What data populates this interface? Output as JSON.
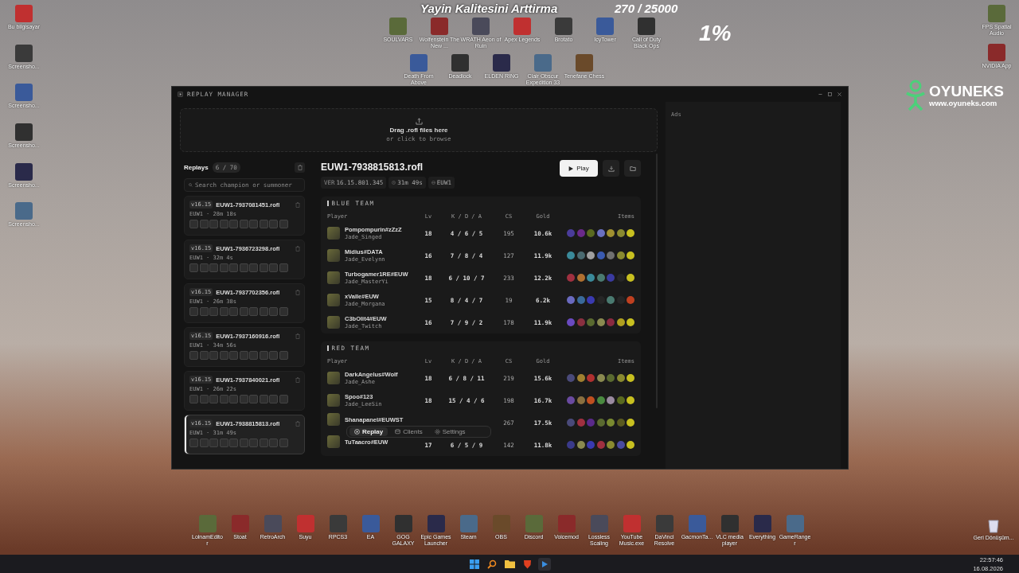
{
  "stream_overlay": {
    "title": "Yayin Kalitesini Arttirma",
    "counter": "270 / 25000",
    "percent": "1%"
  },
  "desktop_icons_top": [
    "SOULVARS",
    "Wolfenstein The New ...",
    "WRATH Aeon of Ruin",
    "Apex Legends",
    "Brotato",
    "IcyTower",
    "Call of Duty Black Ops"
  ],
  "desktop_icons_second": [
    "Death From Above",
    "Deadlock",
    "ELDEN RING",
    "Clair Obscur Expedition 33",
    "Tenefane Chess"
  ],
  "desktop_icons_left": [
    "Bu bilgisayar",
    "Screensho...",
    "Screensho...",
    "Screensho...",
    "Screensho...",
    "Screensho..."
  ],
  "desktop_icons_right": [
    "FPS Spatial Audio",
    "NVIDIA App"
  ],
  "logo": {
    "name": "OYUNEKS",
    "url": "www.oyuneks.com"
  },
  "window": {
    "title": "REPLAY MANAGER",
    "ads_label": "Ads",
    "drop_zone": {
      "title": "Drag .rofl files here",
      "hint": "or click to browse"
    },
    "sidebar": {
      "title": "Replays",
      "count": "6 / 70",
      "search_placeholder": "Search champion or summoner",
      "replays": [
        {
          "version": "v16.15",
          "file": "EUW1-7937081451.rofl",
          "meta": "EUW1 · 28m 18s",
          "selected": false
        },
        {
          "version": "v16.15",
          "file": "EUW1-7936723298.rofl",
          "meta": "EUW1 · 32m 4s",
          "selected": false
        },
        {
          "version": "v16.15",
          "file": "EUW1-7937702356.rofl",
          "meta": "EUW1 · 26m 38s",
          "selected": false
        },
        {
          "version": "v16.15",
          "file": "EUW1-7937160916.rofl",
          "meta": "EUW1 · 34m 56s",
          "selected": false
        },
        {
          "version": "v16.15",
          "file": "EUW1-7937840021.rofl",
          "meta": "EUW1 · 26m 22s",
          "selected": false
        },
        {
          "version": "v16.15",
          "file": "EUW1-7938815813.rofl",
          "meta": "EUW1 · 31m 49s",
          "selected": true
        }
      ]
    },
    "detail": {
      "title": "EUW1-7938815813.rofl",
      "play": "Play",
      "chips": [
        {
          "kind": "version",
          "label": "VER",
          "value": "16.15.801.345"
        },
        {
          "kind": "duration",
          "value": "31m 49s"
        },
        {
          "kind": "region",
          "value": "EUW1"
        }
      ],
      "teams": [
        {
          "name": "BLUE TEAM",
          "columns": [
            "Player",
            "Lv",
            "K / D / A",
            "CS",
            "Gold",
            "Items"
          ],
          "players": [
            {
              "name": "Pompompurin#zZzZ",
              "champion": "Jade_Singed",
              "level": "18",
              "kda": "4 / 6 / 5",
              "cs": "195",
              "gold": "10.6k",
              "items": [
                {
                  "color": "#4a3c9a"
                },
                {
                  "color": "#6a2a8a"
                },
                {
                  "color": "#5a6a20"
                },
                {
                  "color": "#6a70c0"
                },
                {
                  "color": "#a09030"
                },
                {
                  "color": "#8a8a30"
                },
                {
                  "color": "#c8c020"
                }
              ]
            },
            {
              "name": "Midius#DATA",
              "champion": "Jade_Evelynn",
              "level": "16",
              "kda": "7 / 8 / 4",
              "cs": "127",
              "gold": "11.9k",
              "items": [
                {
                  "color": "#3a8a9a"
                },
                {
                  "color": "#4a6a70"
                },
                {
                  "color": "#a0a0a0"
                },
                {
                  "color": "#3a5ab0"
                },
                {
                  "color": "#707070"
                },
                {
                  "color": "#8a8a30"
                },
                {
                  "color": "#c8c020"
                }
              ]
            },
            {
              "name": "Turbogamer1RE#EUW",
              "champion": "Jade_MasterYi",
              "level": "18",
              "kda": "6 / 10 / 7",
              "cs": "233",
              "gold": "12.2k",
              "items": [
                {
                  "color": "#a03040"
                },
                {
                  "color": "#b07030"
                },
                {
                  "color": "#3a8a9a"
                },
                {
                  "color": "#4a7a70"
                },
                {
                  "color": "#3a3aa0"
                },
                {
                  "color": "#262626"
                },
                {
                  "color": "#c8c020"
                }
              ]
            },
            {
              "name": "xValle#EUW",
              "champion": "Jade_Morgana",
              "level": "15",
              "kda": "8 / 4 / 7",
              "cs": "19",
              "gold": "6.2k",
              "items": [
                {
                  "color": "#6a6ac0"
                },
                {
                  "color": "#3a6a9a"
                },
                {
                  "color": "#3a3ab0"
                },
                {
                  "color": "#262626"
                },
                {
                  "color": "#4a7a70"
                },
                {
                  "color": "#262626"
                },
                {
                  "color": "#c04020"
                }
              ]
            },
            {
              "name": "C3bOlit4#EUW",
              "champion": "Jade_Twitch",
              "level": "16",
              "kda": "7 / 9 / 2",
              "cs": "178",
              "gold": "11.9k",
              "items": [
                {
                  "color": "#6a4ac0"
                },
                {
                  "color": "#8a3040"
                },
                {
                  "color": "#5a6a30"
                },
                {
                  "color": "#8a8a50"
                },
                {
                  "color": "#8a2a40"
                },
                {
                  "color": "#b0a020"
                },
                {
                  "color": "#c8c020"
                }
              ]
            }
          ]
        },
        {
          "name": "RED TEAM",
          "columns": [
            "Player",
            "Lv",
            "K / D / A",
            "CS",
            "Gold",
            "Items"
          ],
          "players": [
            {
              "name": "DarkAngelus#Wolf",
              "champion": "Jade_Ashe",
              "level": "18",
              "kda": "6 / 8 / 11",
              "cs": "219",
              "gold": "15.6k",
              "items": [
                {
                  "color": "#4a4a7a"
                },
                {
                  "color": "#a08030"
                },
                {
                  "color": "#b03030"
                },
                {
                  "color": "#8a8a50"
                },
                {
                  "color": "#5a6a30"
                },
                {
                  "color": "#8a8a30"
                },
                {
                  "color": "#c8c020"
                }
              ]
            },
            {
              "name": "Spoo#123",
              "champion": "Jade_LeeSin",
              "level": "18",
              "kda": "15 / 4 / 6",
              "cs": "198",
              "gold": "16.7k",
              "items": [
                {
                  "color": "#6a4aa0"
                },
                {
                  "color": "#8a7040"
                },
                {
                  "color": "#c05020"
                },
                {
                  "color": "#4a8a40"
                },
                {
                  "color": "#9a8aa0"
                },
                {
                  "color": "#5a6a20"
                },
                {
                  "color": "#c8c020"
                }
              ]
            },
            {
              "name": "Shanapanel#EUWST",
              "cs": "267",
              "gold": "17.5k",
              "items": [
                {
                  "color": "#4a4a7a"
                },
                {
                  "color": "#a03040"
                },
                {
                  "color": "#5a2a8a"
                },
                {
                  "color": "#5a6a30"
                },
                {
                  "color": "#7a8a30"
                },
                {
                  "color": "#5a5a20"
                },
                {
                  "color": "#c8c020"
                }
              ]
            },
            {
              "name": "TuTaacro#EUW",
              "level": "17",
              "kda": "6 / 5 / 9",
              "cs": "142",
              "gold": "11.8k",
              "items": [
                {
                  "color": "#3a3a8a"
                },
                {
                  "color": "#8a8a50"
                },
                {
                  "color": "#3a3ab0"
                },
                {
                  "color": "#a03040"
                },
                {
                  "color": "#8a8a30"
                },
                {
                  "color": "#4a4aa0"
                },
                {
                  "color": "#c8c020"
                }
              ]
            }
          ]
        }
      ]
    },
    "nav": [
      {
        "kind": "replay",
        "label": "Replay",
        "selected": true
      },
      {
        "kind": "clients",
        "label": "Clients",
        "selected": false
      },
      {
        "kind": "settings",
        "label": "Settings",
        "selected": false
      }
    ]
  },
  "desktop_icons_bottom": [
    "LolnamEditor",
    "Stoat",
    "RetroArch",
    "Suyu",
    "RPCS3",
    "EA",
    "GOG GALAXY",
    "Epic Games Launcher",
    "Steam",
    "OBS",
    "Discord",
    "Voicemod",
    "Lossless Scaling",
    "YouTube Music.exe",
    "DaVinci Resolve",
    "GacmonTa...",
    "VLC media player",
    "Everything",
    "GameRanger"
  ],
  "recycle_bin": "Geri Dönüşüm...",
  "clock": {
    "time": "22:57:46",
    "date": "16.08.2026"
  }
}
